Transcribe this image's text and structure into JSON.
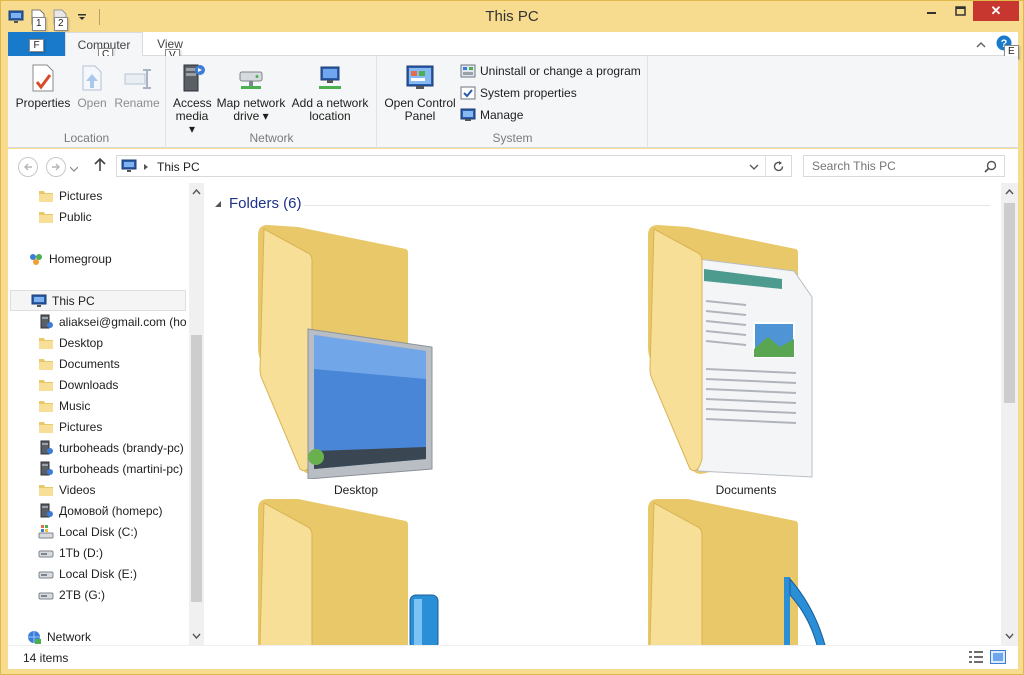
{
  "window": {
    "title": "This PC",
    "minimize_label": "",
    "maximize_label": "",
    "close_label": "✕"
  },
  "quick_access": {
    "keytip_1": "1",
    "keytip_2": "2"
  },
  "ribbon_tabs": {
    "file": "F",
    "computer": "Computer",
    "view": "View",
    "keytip_computer": "C",
    "keytip_view": "V",
    "keytip_help": "E"
  },
  "ribbon": {
    "location": {
      "label": "Location",
      "properties": "Properties",
      "open": "Open",
      "rename": "Rename"
    },
    "network": {
      "label": "Network",
      "access_media_1": "Access",
      "access_media_2": "media ▾",
      "map_drive_1": "Map network",
      "map_drive_2": "drive ▾",
      "add_location_1": "Add a network",
      "add_location_2": "location"
    },
    "system": {
      "label": "System",
      "control_panel_1": "Open Control",
      "control_panel_2": "Panel",
      "uninstall": "Uninstall or change a program",
      "system_properties": "System properties",
      "manage": "Manage"
    }
  },
  "address": {
    "path": "This PC",
    "search_placeholder": "Search This PC"
  },
  "nav_pane": {
    "items": [
      {
        "label": "Pictures",
        "icon": "folder-icon"
      },
      {
        "label": "Public",
        "icon": "folder-icon"
      },
      {
        "label": "Homegroup",
        "icon": "homegroup-icon"
      },
      {
        "label": "This PC",
        "icon": "computer-icon"
      },
      {
        "label": "aliaksei@gmail.com (ho",
        "icon": "network-drive-icon"
      },
      {
        "label": "Desktop",
        "icon": "folder-icon"
      },
      {
        "label": "Documents",
        "icon": "folder-icon"
      },
      {
        "label": "Downloads",
        "icon": "folder-icon"
      },
      {
        "label": "Music",
        "icon": "folder-icon"
      },
      {
        "label": "Pictures",
        "icon": "folder-icon"
      },
      {
        "label": "turboheads (brandy-pc)",
        "icon": "network-drive-icon"
      },
      {
        "label": "turboheads (martini-pc)",
        "icon": "network-drive-icon"
      },
      {
        "label": "Videos",
        "icon": "folder-icon"
      },
      {
        "label": "Домовой (homepc)",
        "icon": "network-drive-icon"
      },
      {
        "label": "Local Disk (C:)",
        "icon": "system-drive-icon"
      },
      {
        "label": "1Tb (D:)",
        "icon": "drive-icon"
      },
      {
        "label": "Local Disk (E:)",
        "icon": "drive-icon"
      },
      {
        "label": "2TB (G:)",
        "icon": "drive-icon"
      },
      {
        "label": "Network",
        "icon": "network-icon"
      }
    ]
  },
  "content": {
    "section_title": "Folders (6)",
    "folders": [
      {
        "label": "Desktop"
      },
      {
        "label": "Documents"
      },
      {
        "label": ""
      },
      {
        "label": ""
      }
    ]
  },
  "status": {
    "items_count": "14 items"
  },
  "colors": {
    "frame": "#f7dc8f",
    "file_tab": "#1979ca",
    "close_button": "#c7372f",
    "section_header": "#1e3287"
  }
}
